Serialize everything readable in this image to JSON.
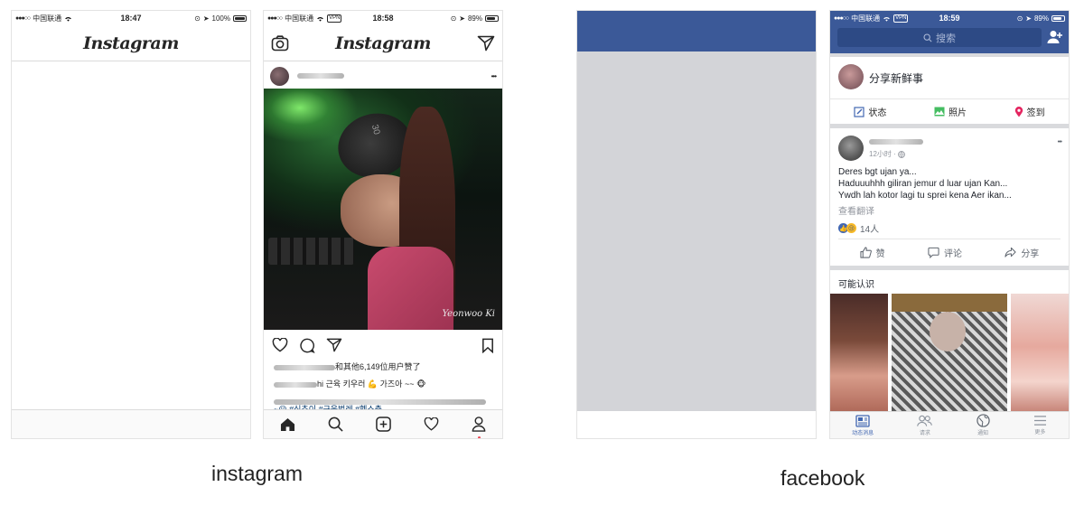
{
  "captions": {
    "instagram": "instagram",
    "facebook": "facebook"
  },
  "ig_blank": {
    "status": {
      "carrier": "中国联通",
      "time": "18:47",
      "battery": "100%"
    },
    "logo": "Instagram"
  },
  "ig_feed": {
    "status": {
      "carrier": "中国联通",
      "vpn": "VPN",
      "time": "18:58",
      "battery": "89%"
    },
    "logo": "Instagram",
    "more": "•••",
    "photo_watermark": "Yeonwoo Ki",
    "photo_text": "30",
    "likes_suffix": "和其他6,149位用户赞了",
    "caption_text": "hi 근육 키우러 💪 가즈아 ~~ 🐵",
    "hashtags": "~😀  #식추이 #근육벌레 #헬스충"
  },
  "fb_blank": {},
  "fb_feed": {
    "status": {
      "carrier": "中国联通",
      "vpn": "VPN",
      "time": "18:59",
      "battery": "89%"
    },
    "search_placeholder": "搜索",
    "share_prompt": "分享新鲜事",
    "actions": [
      {
        "label": "状态",
        "icon": "edit-icon",
        "color": "#4267b2"
      },
      {
        "label": "照片",
        "icon": "photo-icon",
        "color": "#45bd62"
      },
      {
        "label": "签到",
        "icon": "location-pin-icon",
        "color": "#e4245f"
      }
    ],
    "post": {
      "time": "12小时 ·",
      "lines": [
        "Deres bgt ujan ya...",
        "Haduuuhhh giliran jemur d luar ujan Kan...",
        "Ywdh lah kotor lagi tu sprei kena Aer ikan..."
      ],
      "translate": "查看翻译",
      "reactions": "14人",
      "more": "•••",
      "buttons": [
        {
          "label": "赞",
          "icon": "thumbs-up-icon"
        },
        {
          "label": "评论",
          "icon": "comment-icon"
        },
        {
          "label": "分享",
          "icon": "share-icon"
        }
      ]
    },
    "pymk_title": "可能认识",
    "tabs": [
      {
        "label": "动态消息",
        "icon": "news-feed-icon",
        "active": true
      },
      {
        "label": "请求",
        "icon": "friends-icon",
        "active": false
      },
      {
        "label": "通知",
        "icon": "globe-icon",
        "active": false
      },
      {
        "label": "更多",
        "icon": "menu-icon",
        "active": false
      }
    ],
    "colors": {
      "brand": "#3b5998",
      "active_tab": "#4267b2"
    }
  }
}
